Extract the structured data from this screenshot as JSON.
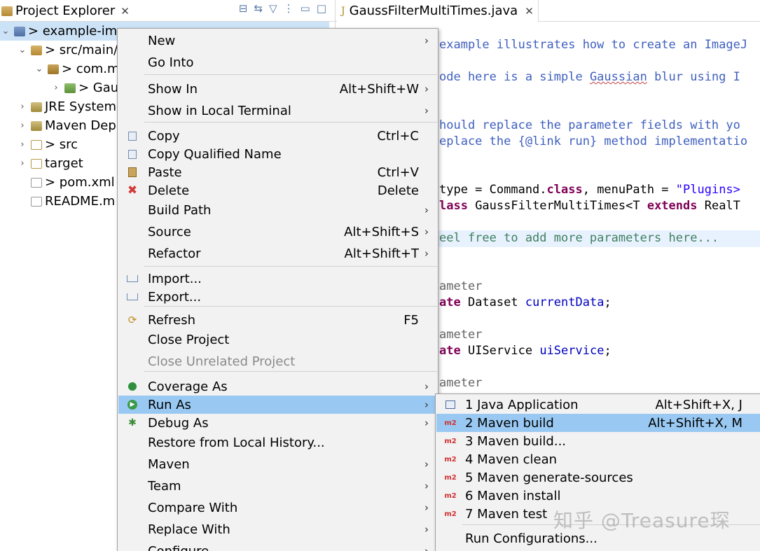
{
  "explorer": {
    "tab_title": "Project Explorer",
    "tab_close": "✕",
    "tree": [
      {
        "label": "> example-im",
        "suffix": "...",
        "twisty": "⌄",
        "icon": "project-icon",
        "indent": 0,
        "selected": true
      },
      {
        "label": "> src/main/",
        "twisty": "⌄",
        "icon": "package-root-icon",
        "indent": 1
      },
      {
        "label": "> com.m",
        "twisty": "⌄",
        "icon": "package-icon",
        "indent": 2
      },
      {
        "label": "> Gau",
        "twisty": "›",
        "icon": "java-file-icon",
        "indent": 3
      },
      {
        "label": "JRE System",
        "twisty": "›",
        "icon": "library-icon",
        "indent": 1
      },
      {
        "label": "Maven Dep",
        "twisty": "›",
        "icon": "library-icon",
        "indent": 1
      },
      {
        "label": "> src",
        "twisty": "›",
        "icon": "folder-icon",
        "indent": 1
      },
      {
        "label": "target",
        "twisty": "›",
        "icon": "folder-icon",
        "indent": 1
      },
      {
        "label": "> pom.xml",
        "twisty": "",
        "icon": "xml-file-icon",
        "indent": 1
      },
      {
        "label": "README.m",
        "twisty": "",
        "icon": "file-icon",
        "indent": 1
      }
    ]
  },
  "editor": {
    "tab_title": "GaussFilterMultiTimes.java",
    "tab_close": "✕",
    "lines": {
      "l1": "example illustrates how to create an ImageJ",
      "l2a": "ode here is a simple ",
      "l2b": "Gaussian",
      "l2c": " blur using I",
      "l3": "hould replace the parameter fields with yo",
      "l4a": "eplace the ",
      "l4b": "{@link run}",
      "l4c": " method implementatio",
      "l5a": "type = Command.",
      "l5b": "class",
      "l5c": ", menuPath = ",
      "l5d": "\"Plugins>",
      "l6a": "lass",
      "l6b": " GaussFilterMultiTimes<T ",
      "l6c": "extends",
      "l6d": " RealT",
      "l7": "eel free to add more parameters here...",
      "l8": "ameter",
      "l9a": "ate",
      "l9b": " Dataset ",
      "l9c": "currentData",
      "l9d": ";",
      "l10": "ameter",
      "l11a": "ate",
      "l11b": " UIService ",
      "l11c": "uiService",
      "l11d": ";",
      "l12": "ameter"
    }
  },
  "context_menu": {
    "items": [
      {
        "label": "New",
        "submenu": true
      },
      {
        "label": "Go Into"
      },
      {
        "label": "Show In",
        "shortcut": "Alt+Shift+W",
        "submenu": true
      },
      {
        "label": "Show in Local Terminal",
        "submenu": true
      },
      {
        "label": "Copy",
        "shortcut": "Ctrl+C",
        "icon": "copy-icon"
      },
      {
        "label": "Copy Qualified Name",
        "icon": "copy-qualified-icon"
      },
      {
        "label": "Paste",
        "shortcut": "Ctrl+V",
        "icon": "paste-icon"
      },
      {
        "label": "Delete",
        "shortcut": "Delete",
        "icon": "delete-icon"
      },
      {
        "label": "Build Path",
        "submenu": true
      },
      {
        "label": "Source",
        "shortcut": "Alt+Shift+S",
        "submenu": true
      },
      {
        "label": "Refactor",
        "shortcut": "Alt+Shift+T",
        "submenu": true
      },
      {
        "label": "Import...",
        "icon": "import-icon"
      },
      {
        "label": "Export...",
        "icon": "export-icon"
      },
      {
        "label": "Refresh",
        "shortcut": "F5",
        "icon": "refresh-icon"
      },
      {
        "label": "Close Project"
      },
      {
        "label": "Close Unrelated Project",
        "disabled": true
      },
      {
        "label": "Coverage As",
        "submenu": true,
        "icon": "coverage-icon"
      },
      {
        "label": "Run As",
        "submenu": true,
        "icon": "run-icon",
        "hover": true
      },
      {
        "label": "Debug As",
        "submenu": true,
        "icon": "debug-icon"
      },
      {
        "label": "Restore from Local History..."
      },
      {
        "label": "Maven",
        "submenu": true
      },
      {
        "label": "Team",
        "submenu": true
      },
      {
        "label": "Compare With",
        "submenu": true
      },
      {
        "label": "Replace With",
        "submenu": true
      },
      {
        "label": "Configure",
        "submenu": true
      }
    ]
  },
  "run_as_submenu": {
    "items": [
      {
        "label": "1 Java Application",
        "shortcut": "Alt+Shift+X, J",
        "icon": "java-app-icon"
      },
      {
        "label": "2 Maven build",
        "shortcut": "Alt+Shift+X, M",
        "icon": "maven-icon",
        "hover": true
      },
      {
        "label": "3 Maven build...",
        "icon": "maven-icon"
      },
      {
        "label": "4 Maven clean",
        "icon": "maven-icon"
      },
      {
        "label": "5 Maven generate-sources",
        "icon": "maven-icon"
      },
      {
        "label": "6 Maven install",
        "icon": "maven-icon"
      },
      {
        "label": "7 Maven test",
        "icon": "maven-icon"
      },
      {
        "label": "Run Configurations..."
      }
    ],
    "maven_icon_text": "m2"
  },
  "watermark": "知乎 @Treasure琛",
  "colors": {
    "menu_bg": "#f2f2f2",
    "hover": "#99c9f2",
    "selection": "#cce3f7",
    "comment": "#3f5fbf",
    "keyword": "#7f0055",
    "string": "#2a00ff"
  }
}
